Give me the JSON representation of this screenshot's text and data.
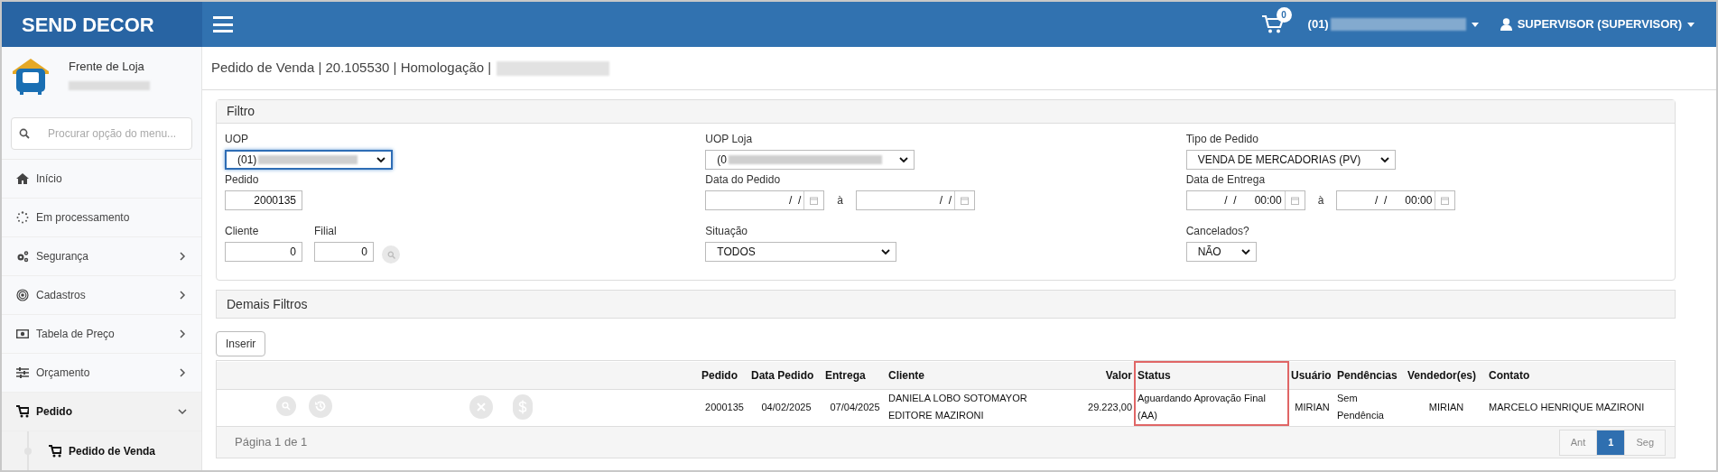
{
  "brand": "SEND DECOR",
  "header": {
    "cart_count": "0",
    "company": "(01)",
    "user": "SUPERVISOR (SUPERVISOR)"
  },
  "sidebar": {
    "title": "Frente de Loja",
    "search": {
      "placeholder": "Procurar opção do menu..."
    },
    "items": [
      {
        "label": "Início",
        "kind": "link",
        "selected": false
      },
      {
        "label": "Em processamento",
        "kind": "link",
        "selected": false
      },
      {
        "label": "Segurança",
        "kind": "group",
        "expanded": false,
        "selected": false
      },
      {
        "label": "Cadastros",
        "kind": "group",
        "expanded": false,
        "selected": false
      },
      {
        "label": "Tabela de Preço",
        "kind": "group",
        "expanded": false,
        "selected": false
      },
      {
        "label": "Orçamento",
        "kind": "group",
        "expanded": false,
        "selected": false
      },
      {
        "label": "Pedido",
        "kind": "group",
        "expanded": true,
        "selected": true,
        "children": [
          {
            "label": "Pedido de Venda",
            "selected": true
          }
        ]
      }
    ]
  },
  "page_title": "Pedido de Venda | 20.105530 | Homologação |",
  "filter": {
    "title": "Filtro",
    "fields": [
      {
        "kind": "select",
        "label": "UOP",
        "value": "(01)",
        "focused": true
      },
      {
        "kind": "select",
        "label": "UOP Loja",
        "value": "(0",
        "focused": false
      },
      {
        "kind": "select",
        "label": "Tipo de Pedido",
        "value": "VENDA DE MERCADORIAS (PV)",
        "focused": false
      },
      {
        "kind": "input",
        "label": "Pedido",
        "value": "2000135"
      },
      {
        "kind": "daterange",
        "label": "Data do Pedido",
        "from": " /  /",
        "to": " /  /",
        "separator": "à"
      },
      {
        "kind": "daterange",
        "label": "Data de Entrega",
        "from": " /  /      00:00",
        "to": " /  /      00:00",
        "separator": "à"
      },
      {
        "kind": "clientfilial",
        "label": "Cliente",
        "value": "0",
        "label2": "Filial",
        "value2": "0"
      },
      {
        "kind": "select",
        "label": "Situação",
        "value": "TODOS",
        "focused": false
      },
      {
        "kind": "select",
        "label": "Cancelados?",
        "value": "NÃO",
        "focused": false
      }
    ]
  },
  "other_filters": {
    "title": "Demais Filtros"
  },
  "insert_button": "Inserir",
  "table": {
    "columns": [
      {
        "label": "Pedido",
        "highlighted": false
      },
      {
        "label": "Data Pedido",
        "highlighted": false
      },
      {
        "label": "Entrega",
        "highlighted": false
      },
      {
        "label": "Cliente",
        "highlighted": false
      },
      {
        "label": "Valor",
        "highlighted": false
      },
      {
        "label": "Status",
        "highlighted": true
      },
      {
        "label": "Usuário",
        "highlighted": false
      },
      {
        "label": "Pendências",
        "highlighted": false
      },
      {
        "label": "Vendedor(es)",
        "highlighted": false
      },
      {
        "label": "Contato",
        "highlighted": false
      }
    ],
    "rows": [
      {
        "pedido": "2000135",
        "data_pedido": "04/02/2025",
        "entrega": "07/04/2025",
        "cliente": "DANIELA LOBO SOTOMAYOR EDITORE MAZIRONI",
        "valor": "29.223,00",
        "status": "Aguardando Aprovação Final (AA)",
        "usuario": "MIRIAN",
        "pendencias": "Sem Pendência",
        "vendedor": "MIRIAN",
        "contato": "MARCELO HENRIQUE MAZIRONI"
      }
    ],
    "page_info": "Página 1 de 1",
    "pagination": [
      {
        "label": "Ant",
        "selected": false
      },
      {
        "label": "1",
        "selected": true
      },
      {
        "label": "Seg",
        "selected": false
      }
    ]
  }
}
